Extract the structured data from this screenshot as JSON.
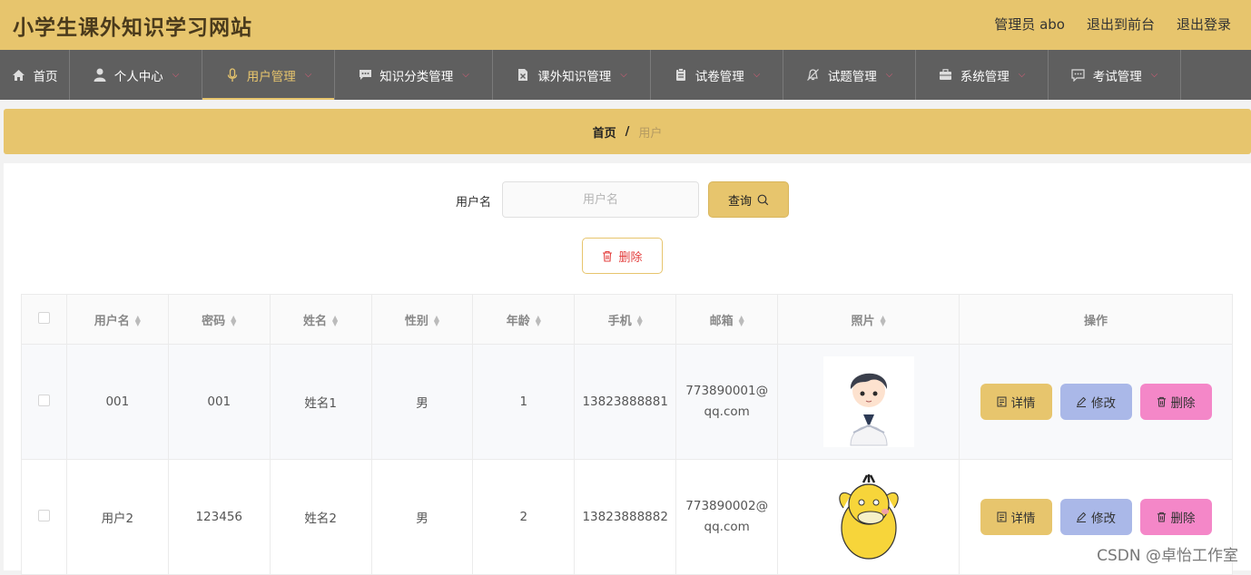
{
  "header": {
    "site_title": "小学生课外知识学习网站",
    "admin_label": "管理员 abo",
    "to_front": "退出到前台",
    "logout": "退出登录"
  },
  "nav": [
    {
      "label": "首页",
      "icon": "home-icon",
      "chevron": false,
      "active": false
    },
    {
      "label": "个人中心",
      "icon": "user-icon",
      "chevron": true,
      "active": false
    },
    {
      "label": "用户管理",
      "icon": "microphone-icon",
      "chevron": true,
      "active": true
    },
    {
      "label": "知识分类管理",
      "icon": "chat-icon",
      "chevron": true,
      "active": false
    },
    {
      "label": "课外知识管理",
      "icon": "document-x-icon",
      "chevron": true,
      "active": false
    },
    {
      "label": "试卷管理",
      "icon": "clipboard-icon",
      "chevron": true,
      "active": false
    },
    {
      "label": "试题管理",
      "icon": "bell-off-icon",
      "chevron": true,
      "active": false
    },
    {
      "label": "系统管理",
      "icon": "briefcase-icon",
      "chevron": true,
      "active": false
    },
    {
      "label": "考试管理",
      "icon": "message-icon",
      "chevron": true,
      "active": false
    }
  ],
  "breadcrumb": {
    "home": "首页",
    "separator": "/",
    "current": "用户"
  },
  "search": {
    "label": "用户名",
    "placeholder": "用户名",
    "button": "查询"
  },
  "batch_delete": "删除",
  "table": {
    "columns": [
      "用户名",
      "密码",
      "姓名",
      "性别",
      "年龄",
      "手机",
      "邮箱",
      "照片",
      "操作"
    ],
    "rows": [
      {
        "username": "001",
        "password": "001",
        "name": "姓名1",
        "gender": "男",
        "age": "1",
        "phone": "13823888881",
        "email_1": "773890001@",
        "email_2": "qq.com",
        "photo": "boy-avatar"
      },
      {
        "username": "用户2",
        "password": "123456",
        "name": "姓名2",
        "gender": "男",
        "age": "2",
        "phone": "13823888882",
        "email_1": "773890002@",
        "email_2": "qq.com",
        "photo": "yellow-duck-avatar"
      }
    ],
    "actions": {
      "detail": "详情",
      "edit": "修改",
      "delete": "删除"
    }
  },
  "watermark": "CSDN @卓怡工作室",
  "colors": {
    "accent": "#e7c56d",
    "nav_bg": "#5f5f5f",
    "edit": "#aab8e8",
    "delete": "#f487c8",
    "danger_text": "#e3403f"
  }
}
